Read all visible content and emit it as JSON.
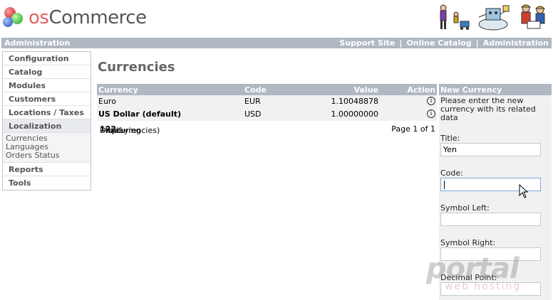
{
  "logo": {
    "prefix": "os",
    "suffix": "Commerce"
  },
  "topbar": {
    "left": "Administration",
    "links": [
      "Support Site",
      "Online Catalog",
      "Administration"
    ]
  },
  "nav": {
    "configuration": "Configuration",
    "catalog": "Catalog",
    "modules": "Modules",
    "customers": "Customers",
    "locations": "Locations / Taxes",
    "localization": "Localization",
    "sub": [
      "Currencies",
      "Languages",
      "Orders Status"
    ],
    "reports": "Reports",
    "tools": "Tools"
  },
  "page_title": "Currencies",
  "table": {
    "headers": {
      "currency": "Currency",
      "code": "Code",
      "value": "Value",
      "action": "Action"
    },
    "rows": [
      {
        "currency": "Euro",
        "code": "EUR",
        "value": "1.10048878",
        "bold": false
      },
      {
        "currency": "US Dollar (default)",
        "code": "USD",
        "value": "1.00000000",
        "bold": true
      }
    ],
    "footer": {
      "display_prefix": "Displaying ",
      "from": "1",
      "to_word": " to ",
      "to": "2",
      "of_prefix": " (of ",
      "total": "2",
      "of_suffix": " currencies)",
      "page": "Page 1 of 1"
    }
  },
  "new_currency": {
    "title": "New Currency",
    "intro": "Please enter the new currency with its related data",
    "fields": {
      "title_label": "Title:",
      "title_value": "Yen",
      "code_label": "Code:",
      "code_value": "",
      "symbol_left_label": "Symbol Left:",
      "symbol_right_label": "Symbol Right:",
      "decimal_point_label": "Decimal Point:"
    }
  },
  "watermark": {
    "main": "portal",
    "sub": "web hosting"
  },
  "icons": {
    "info": "info-icon",
    "mouse": "mouse-pointer-icon"
  }
}
